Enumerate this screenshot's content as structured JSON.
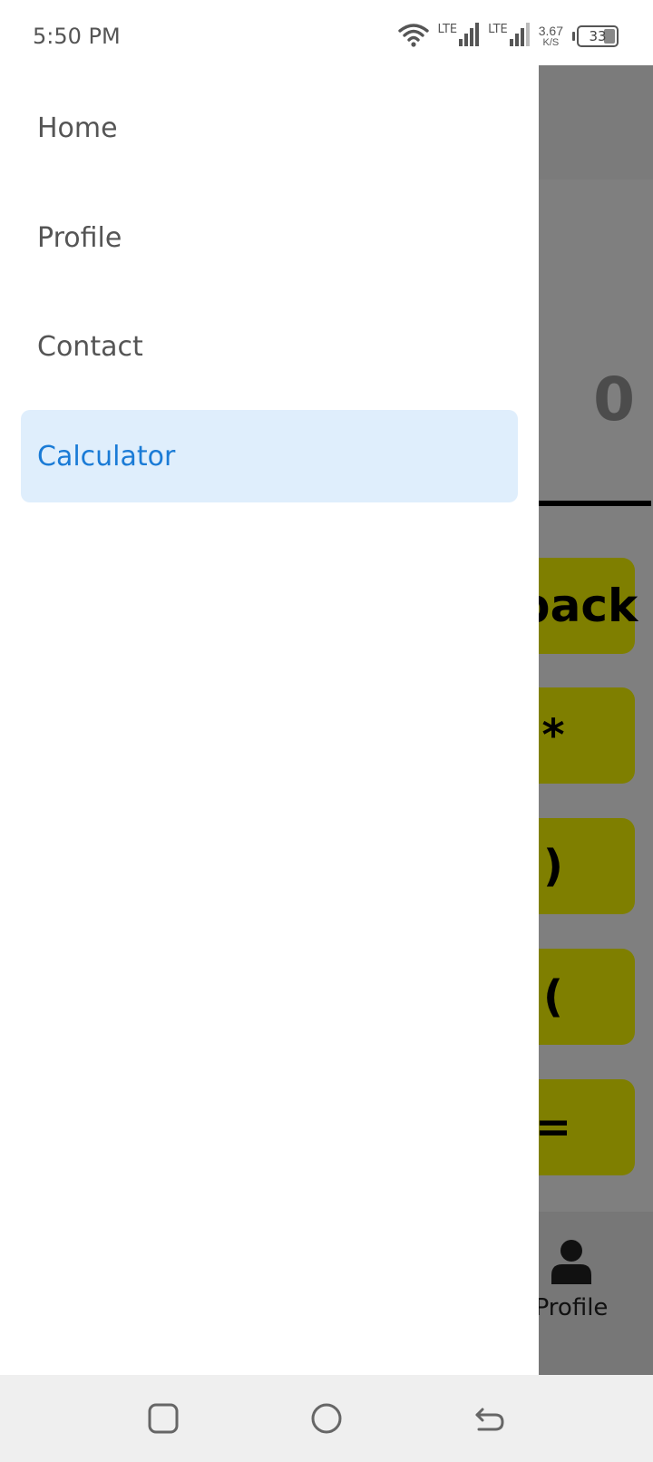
{
  "status_bar": {
    "time": "5:50 PM",
    "sim1_label": "LTE",
    "sim2_label": "LTE",
    "speed_value": "3.67",
    "speed_unit": "K/S",
    "battery_level": "33",
    "icons": [
      "wifi-icon",
      "signal-icon",
      "signal-icon",
      "battery-icon"
    ]
  },
  "drawer": {
    "items": [
      {
        "label": "Home",
        "selected": false
      },
      {
        "label": "Profile",
        "selected": false
      },
      {
        "label": "Contact",
        "selected": false
      },
      {
        "label": "Calculator",
        "selected": true
      }
    ],
    "selected_bg": "#dfeefc",
    "selected_color": "#1a7bd6"
  },
  "background": {
    "display_value": "0",
    "keys": [
      "back",
      "*",
      ")",
      "(",
      "="
    ],
    "bottom_nav": {
      "profile_label": "Profile",
      "icon": "user-icon"
    },
    "key_color": "#fefe00"
  },
  "system_nav": {
    "buttons": [
      "recent-apps-icon",
      "home-circle-icon",
      "back-icon"
    ]
  }
}
